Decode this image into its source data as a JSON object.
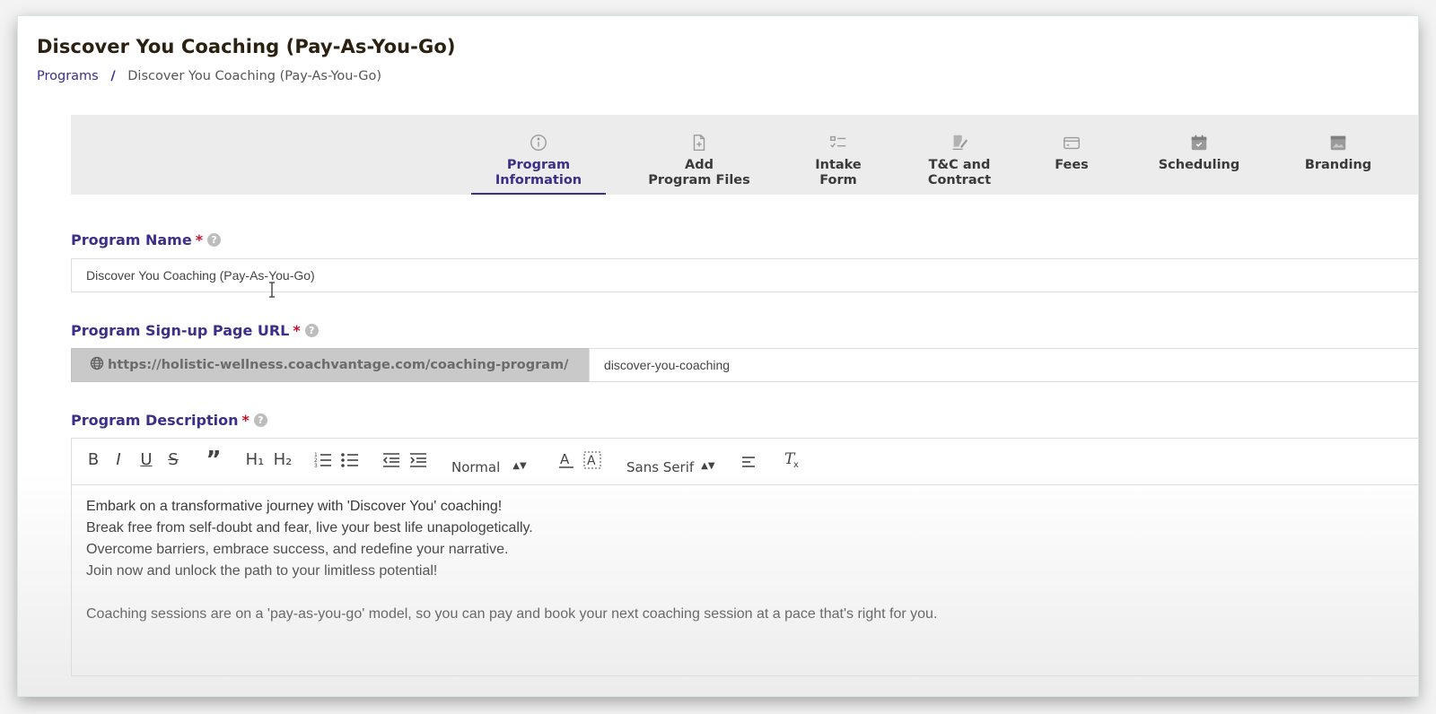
{
  "header": {
    "title": "Discover You Coaching (Pay-As-You-Go)",
    "breadcrumb": {
      "root": "Programs",
      "separator": "/",
      "current": "Discover You Coaching (Pay-As-You-Go)"
    }
  },
  "tabs": [
    {
      "line1": "Program",
      "line2": "Information",
      "icon": "info-circle-icon",
      "active": true
    },
    {
      "line1": "Add",
      "line2": "Program Files",
      "icon": "file-add-icon",
      "active": false
    },
    {
      "line1": "Intake",
      "line2": "Form",
      "icon": "checklist-icon",
      "active": false
    },
    {
      "line1": "T&C and",
      "line2": "Contract",
      "icon": "contract-sign-icon",
      "active": false
    },
    {
      "line1": "Fees",
      "line2": "",
      "icon": "credit-card-icon",
      "active": false
    },
    {
      "line1": "Scheduling",
      "line2": "",
      "icon": "calendar-icon",
      "active": false
    },
    {
      "line1": "Branding",
      "line2": "",
      "icon": "branding-image-icon",
      "active": false
    }
  ],
  "form": {
    "program_name": {
      "label": "Program Name",
      "required_mark": "*",
      "value": "Discover You Coaching (Pay-As-You-Go)"
    },
    "signup_url": {
      "label": "Program Sign-up Page URL",
      "required_mark": "*",
      "prefix": "https://holistic-wellness.coachvantage.com/coaching-program/",
      "slug": "discover-you-coaching"
    },
    "description": {
      "label": "Program Description",
      "required_mark": "*",
      "toolbar": {
        "bold": "B",
        "italic": "I",
        "underline": "U",
        "strike": "S",
        "quote": "”",
        "h1": "H₁",
        "h2": "H₂",
        "header_select": "Normal",
        "font_select": "Sans Serif"
      },
      "paragraphs": [
        "Embark on a transformative journey with 'Discover You' coaching!",
        "Break free from self-doubt and fear, live your best life unapologetically.",
        "Overcome barriers, embrace success, and redefine your narrative.",
        "Join now and unlock the path to your limitless potential!",
        "Coaching sessions are on a 'pay-as-you-go' model, so you can pay and book your next coaching session at a pace that's right for you."
      ]
    }
  },
  "colors": {
    "accent": "#3b2f88",
    "required": "#c8102e",
    "tabs_bg": "#ececec",
    "url_prefix_bg": "#c9c9c9"
  }
}
